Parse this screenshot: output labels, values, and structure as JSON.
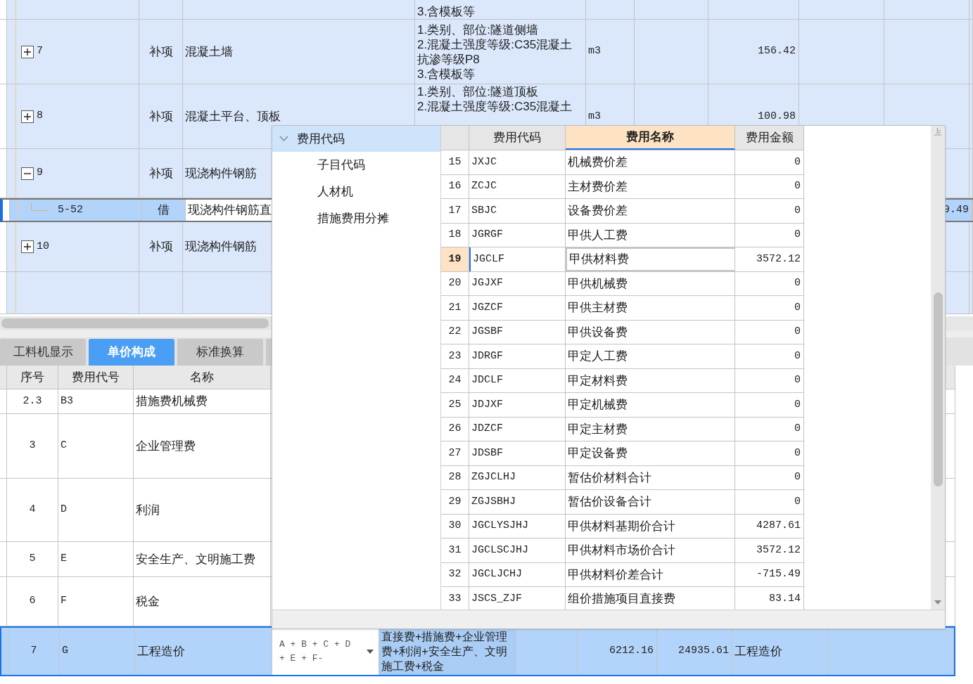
{
  "item_grid": {
    "rows": [
      {
        "kind": "item",
        "description": [
          "3.含模板等"
        ]
      },
      {
        "kind": "item",
        "code": "7",
        "expanded": false,
        "type": "补项",
        "name": "混凝土墙",
        "description": [
          "1.类别、部位:隧道侧墙",
          "2.混凝土强度等级:C35混凝土",
          "抗渗等级P8",
          "3.含模板等"
        ],
        "unit": "m3",
        "quantity": "156.42"
      },
      {
        "kind": "item",
        "code": "8",
        "expanded": false,
        "type": "补项",
        "name": "混凝土平台、顶板",
        "description": [
          "1.类别、部位:隧道顶板",
          "2.混凝土强度等级:C35混凝土"
        ],
        "unit": "m3",
        "quantity": "100.98"
      },
      {
        "kind": "item",
        "code": "9",
        "expanded": true,
        "type": "补项",
        "name": "现浇构件钢筋"
      },
      {
        "kind": "child",
        "selected": true,
        "code": "5-52",
        "type": "借",
        "name": "现浇构件钢筋直",
        "column_11": "9.49"
      },
      {
        "kind": "item",
        "code": "10",
        "expanded": false,
        "type": "补项",
        "name": "现浇构件钢筋"
      },
      {
        "kind": "item"
      }
    ]
  },
  "tabs": [
    {
      "label": "工料机显示",
      "selected": false
    },
    {
      "label": "单价构成",
      "selected": true
    },
    {
      "label": "标准换算",
      "selected": false
    }
  ],
  "cost_table": {
    "columns": [
      "序号",
      "费用代号",
      "名称"
    ],
    "rows": [
      {
        "seq": "2.3",
        "code": "B3",
        "name": "措施费机械费",
        "selected": false
      },
      {
        "seq": "3",
        "code": "C",
        "name": "企业管理费",
        "selected": false
      },
      {
        "seq": "4",
        "code": "D",
        "name": "利润",
        "selected": false
      },
      {
        "seq": "5",
        "code": "E",
        "name": "安全生产、文明施工费",
        "selected": false
      },
      {
        "seq": "6",
        "code": "F",
        "name": "税金",
        "selected": false
      },
      {
        "seq": "7",
        "code": "G",
        "name": "工程造价",
        "selected": true,
        "base": "A + B + C + D + E + F-",
        "base_description": "直接费+措施费+企业管理费+利润+安全生产、文明施工费+税金",
        "column_7": "6212.16",
        "column_8": "24935.61",
        "column_9": "工程造价"
      }
    ]
  },
  "popup": {
    "tree": [
      {
        "label": "费用代码",
        "expanded": true,
        "selected": true,
        "children": [
          {
            "label": "子目代码",
            "selected": false
          },
          {
            "label": "人材机",
            "selected": false
          },
          {
            "label": "措施费用分摊",
            "selected": false
          }
        ]
      }
    ],
    "columns": [
      {
        "label": "费用代码",
        "selected": false
      },
      {
        "label": "费用名称",
        "selected": true
      },
      {
        "label": "费用金额",
        "selected": false
      }
    ],
    "rows": [
      {
        "index": "15",
        "code": "JXJC",
        "name": "机械费价差",
        "amount": "0",
        "selected": false
      },
      {
        "index": "16",
        "code": "ZCJC",
        "name": "主材费价差",
        "amount": "0",
        "selected": false
      },
      {
        "index": "17",
        "code": "SBJC",
        "name": "设备费价差",
        "amount": "0",
        "selected": false
      },
      {
        "index": "18",
        "code": "JGRGF",
        "name": "甲供人工费",
        "amount": "0",
        "selected": false
      },
      {
        "index": "19",
        "code": "JGCLF",
        "name": "甲供材料费",
        "amount": "3572.12",
        "selected": true
      },
      {
        "index": "20",
        "code": "JGJXF",
        "name": "甲供机械费",
        "amount": "0",
        "selected": false
      },
      {
        "index": "21",
        "code": "JGZCF",
        "name": "甲供主材费",
        "amount": "0",
        "selected": false
      },
      {
        "index": "22",
        "code": "JGSBF",
        "name": "甲供设备费",
        "amount": "0",
        "selected": false
      },
      {
        "index": "23",
        "code": "JDRGF",
        "name": "甲定人工费",
        "amount": "0",
        "selected": false
      },
      {
        "index": "24",
        "code": "JDCLF",
        "name": "甲定材料费",
        "amount": "0",
        "selected": false
      },
      {
        "index": "25",
        "code": "JDJXF",
        "name": "甲定机械费",
        "amount": "0",
        "selected": false
      },
      {
        "index": "26",
        "code": "JDZCF",
        "name": "甲定主材费",
        "amount": "0",
        "selected": false
      },
      {
        "index": "27",
        "code": "JDSBF",
        "name": "甲定设备费",
        "amount": "0",
        "selected": false
      },
      {
        "index": "28",
        "code": "ZGJCLHJ",
        "name": "暂估价材料合计",
        "amount": "0",
        "selected": false
      },
      {
        "index": "29",
        "code": "ZGJSBHJ",
        "name": "暂估价设备合计",
        "amount": "0",
        "selected": false
      },
      {
        "index": "30",
        "code": "JGCLYSJHJ",
        "name": "甲供材料基期价合计",
        "amount": "4287.61",
        "selected": false
      },
      {
        "index": "31",
        "code": "JGCLSCJHJ",
        "name": "甲供材料市场价合计",
        "amount": "3572.12",
        "selected": false
      },
      {
        "index": "32",
        "code": "JGCLJCHJ",
        "name": "甲供材料价差合计",
        "amount": "-715.49",
        "selected": false
      },
      {
        "index": "33",
        "code": "JSCS_ZJF",
        "name": "组价措施项目直接费",
        "amount": "83.14",
        "selected": false
      }
    ]
  }
}
